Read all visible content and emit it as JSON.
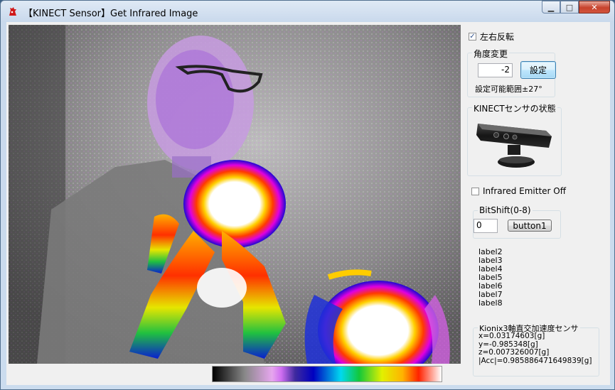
{
  "window": {
    "title": "【KINECT Sensor】Get Infrared Image",
    "icon": "kinect-app-icon",
    "controls": {
      "minimize": "▁",
      "maximize": "□",
      "close": "✕"
    }
  },
  "side": {
    "mirror_checkbox": {
      "label": "左右反転",
      "checked": true
    },
    "angle_group": {
      "title": "角度変更",
      "angle_value": "-2",
      "set_button": "設定",
      "range_text": "設定可能範囲±27°"
    },
    "sensor_group": {
      "title": "KINECTセンサの状態"
    },
    "emitter_checkbox": {
      "label": "Infrared Emitter Off",
      "checked": false
    },
    "bitshift_group": {
      "title": "BitShift(0-8)",
      "value": "0",
      "button": "button1"
    },
    "labels": [
      "label2",
      "label3",
      "label4",
      "label5",
      "label6",
      "label7",
      "label8"
    ],
    "accel_group": {
      "title": "Kionix3軸直交加速度センサ",
      "lines": [
        "x=0.03174603[g]",
        "y=-0.985348[g]",
        "z=0.007326007[g]",
        "|Acc|=0.985886471649839[g]"
      ]
    }
  },
  "colors": {
    "window_frame": "#cbdcee",
    "client_bg": "#f0f0f0",
    "close_button": "#c7422d"
  }
}
